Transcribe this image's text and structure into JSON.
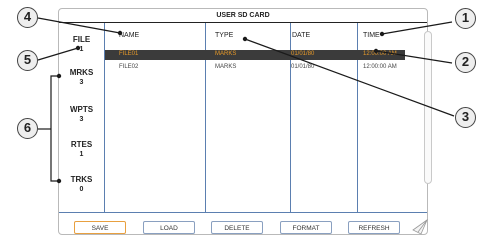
{
  "screen": {
    "title": "USER SD CARD"
  },
  "sidebar": {
    "file": {
      "label": "FILE",
      "value": "1"
    },
    "counts": [
      {
        "label": "MRKS",
        "value": "3"
      },
      {
        "label": "WPTS",
        "value": "3"
      },
      {
        "label": "RTES",
        "value": "1"
      },
      {
        "label": "TRKS",
        "value": "0"
      }
    ]
  },
  "table": {
    "headers": {
      "name": "NAME",
      "type": "TYPE",
      "date": "DATE",
      "time": "TIME"
    },
    "rows": [
      {
        "name": "FILE01",
        "type": "MARKS",
        "date": "01/01/80",
        "time": "12:00:00 AM",
        "selected": true
      },
      {
        "name": "FILE02",
        "type": "MARKS",
        "date": "01/01/80",
        "time": "12:00:00 AM",
        "selected": false
      }
    ]
  },
  "buttons": [
    {
      "label": "SAVE"
    },
    {
      "label": "LOAD"
    },
    {
      "label": "DELETE"
    },
    {
      "label": "FORMAT"
    },
    {
      "label": "REFRESH"
    }
  ],
  "callouts": [
    "1",
    "2",
    "3",
    "4",
    "5",
    "6"
  ],
  "colors": {
    "selected_row_bg": "#3b3b3b",
    "selected_row_text": "#e89a28",
    "divider": "#5b7fb0"
  }
}
